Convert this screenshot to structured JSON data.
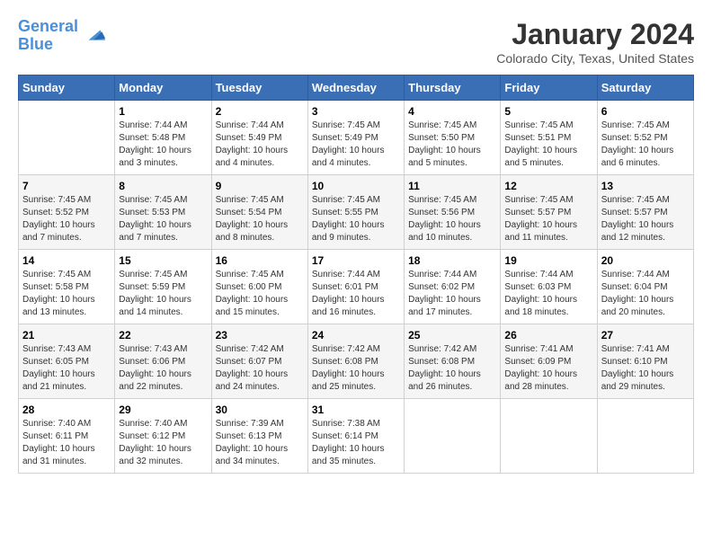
{
  "header": {
    "logo_line1": "General",
    "logo_line2": "Blue",
    "month": "January 2024",
    "location": "Colorado City, Texas, United States"
  },
  "weekdays": [
    "Sunday",
    "Monday",
    "Tuesday",
    "Wednesday",
    "Thursday",
    "Friday",
    "Saturday"
  ],
  "weeks": [
    [
      {
        "day": "",
        "info": ""
      },
      {
        "day": "1",
        "info": "Sunrise: 7:44 AM\nSunset: 5:48 PM\nDaylight: 10 hours\nand 3 minutes."
      },
      {
        "day": "2",
        "info": "Sunrise: 7:44 AM\nSunset: 5:49 PM\nDaylight: 10 hours\nand 4 minutes."
      },
      {
        "day": "3",
        "info": "Sunrise: 7:45 AM\nSunset: 5:49 PM\nDaylight: 10 hours\nand 4 minutes."
      },
      {
        "day": "4",
        "info": "Sunrise: 7:45 AM\nSunset: 5:50 PM\nDaylight: 10 hours\nand 5 minutes."
      },
      {
        "day": "5",
        "info": "Sunrise: 7:45 AM\nSunset: 5:51 PM\nDaylight: 10 hours\nand 5 minutes."
      },
      {
        "day": "6",
        "info": "Sunrise: 7:45 AM\nSunset: 5:52 PM\nDaylight: 10 hours\nand 6 minutes."
      }
    ],
    [
      {
        "day": "7",
        "info": "Sunrise: 7:45 AM\nSunset: 5:52 PM\nDaylight: 10 hours\nand 7 minutes."
      },
      {
        "day": "8",
        "info": "Sunrise: 7:45 AM\nSunset: 5:53 PM\nDaylight: 10 hours\nand 7 minutes."
      },
      {
        "day": "9",
        "info": "Sunrise: 7:45 AM\nSunset: 5:54 PM\nDaylight: 10 hours\nand 8 minutes."
      },
      {
        "day": "10",
        "info": "Sunrise: 7:45 AM\nSunset: 5:55 PM\nDaylight: 10 hours\nand 9 minutes."
      },
      {
        "day": "11",
        "info": "Sunrise: 7:45 AM\nSunset: 5:56 PM\nDaylight: 10 hours\nand 10 minutes."
      },
      {
        "day": "12",
        "info": "Sunrise: 7:45 AM\nSunset: 5:57 PM\nDaylight: 10 hours\nand 11 minutes."
      },
      {
        "day": "13",
        "info": "Sunrise: 7:45 AM\nSunset: 5:57 PM\nDaylight: 10 hours\nand 12 minutes."
      }
    ],
    [
      {
        "day": "14",
        "info": "Sunrise: 7:45 AM\nSunset: 5:58 PM\nDaylight: 10 hours\nand 13 minutes."
      },
      {
        "day": "15",
        "info": "Sunrise: 7:45 AM\nSunset: 5:59 PM\nDaylight: 10 hours\nand 14 minutes."
      },
      {
        "day": "16",
        "info": "Sunrise: 7:45 AM\nSunset: 6:00 PM\nDaylight: 10 hours\nand 15 minutes."
      },
      {
        "day": "17",
        "info": "Sunrise: 7:44 AM\nSunset: 6:01 PM\nDaylight: 10 hours\nand 16 minutes."
      },
      {
        "day": "18",
        "info": "Sunrise: 7:44 AM\nSunset: 6:02 PM\nDaylight: 10 hours\nand 17 minutes."
      },
      {
        "day": "19",
        "info": "Sunrise: 7:44 AM\nSunset: 6:03 PM\nDaylight: 10 hours\nand 18 minutes."
      },
      {
        "day": "20",
        "info": "Sunrise: 7:44 AM\nSunset: 6:04 PM\nDaylight: 10 hours\nand 20 minutes."
      }
    ],
    [
      {
        "day": "21",
        "info": "Sunrise: 7:43 AM\nSunset: 6:05 PM\nDaylight: 10 hours\nand 21 minutes."
      },
      {
        "day": "22",
        "info": "Sunrise: 7:43 AM\nSunset: 6:06 PM\nDaylight: 10 hours\nand 22 minutes."
      },
      {
        "day": "23",
        "info": "Sunrise: 7:42 AM\nSunset: 6:07 PM\nDaylight: 10 hours\nand 24 minutes."
      },
      {
        "day": "24",
        "info": "Sunrise: 7:42 AM\nSunset: 6:08 PM\nDaylight: 10 hours\nand 25 minutes."
      },
      {
        "day": "25",
        "info": "Sunrise: 7:42 AM\nSunset: 6:08 PM\nDaylight: 10 hours\nand 26 minutes."
      },
      {
        "day": "26",
        "info": "Sunrise: 7:41 AM\nSunset: 6:09 PM\nDaylight: 10 hours\nand 28 minutes."
      },
      {
        "day": "27",
        "info": "Sunrise: 7:41 AM\nSunset: 6:10 PM\nDaylight: 10 hours\nand 29 minutes."
      }
    ],
    [
      {
        "day": "28",
        "info": "Sunrise: 7:40 AM\nSunset: 6:11 PM\nDaylight: 10 hours\nand 31 minutes."
      },
      {
        "day": "29",
        "info": "Sunrise: 7:40 AM\nSunset: 6:12 PM\nDaylight: 10 hours\nand 32 minutes."
      },
      {
        "day": "30",
        "info": "Sunrise: 7:39 AM\nSunset: 6:13 PM\nDaylight: 10 hours\nand 34 minutes."
      },
      {
        "day": "31",
        "info": "Sunrise: 7:38 AM\nSunset: 6:14 PM\nDaylight: 10 hours\nand 35 minutes."
      },
      {
        "day": "",
        "info": ""
      },
      {
        "day": "",
        "info": ""
      },
      {
        "day": "",
        "info": ""
      }
    ]
  ]
}
